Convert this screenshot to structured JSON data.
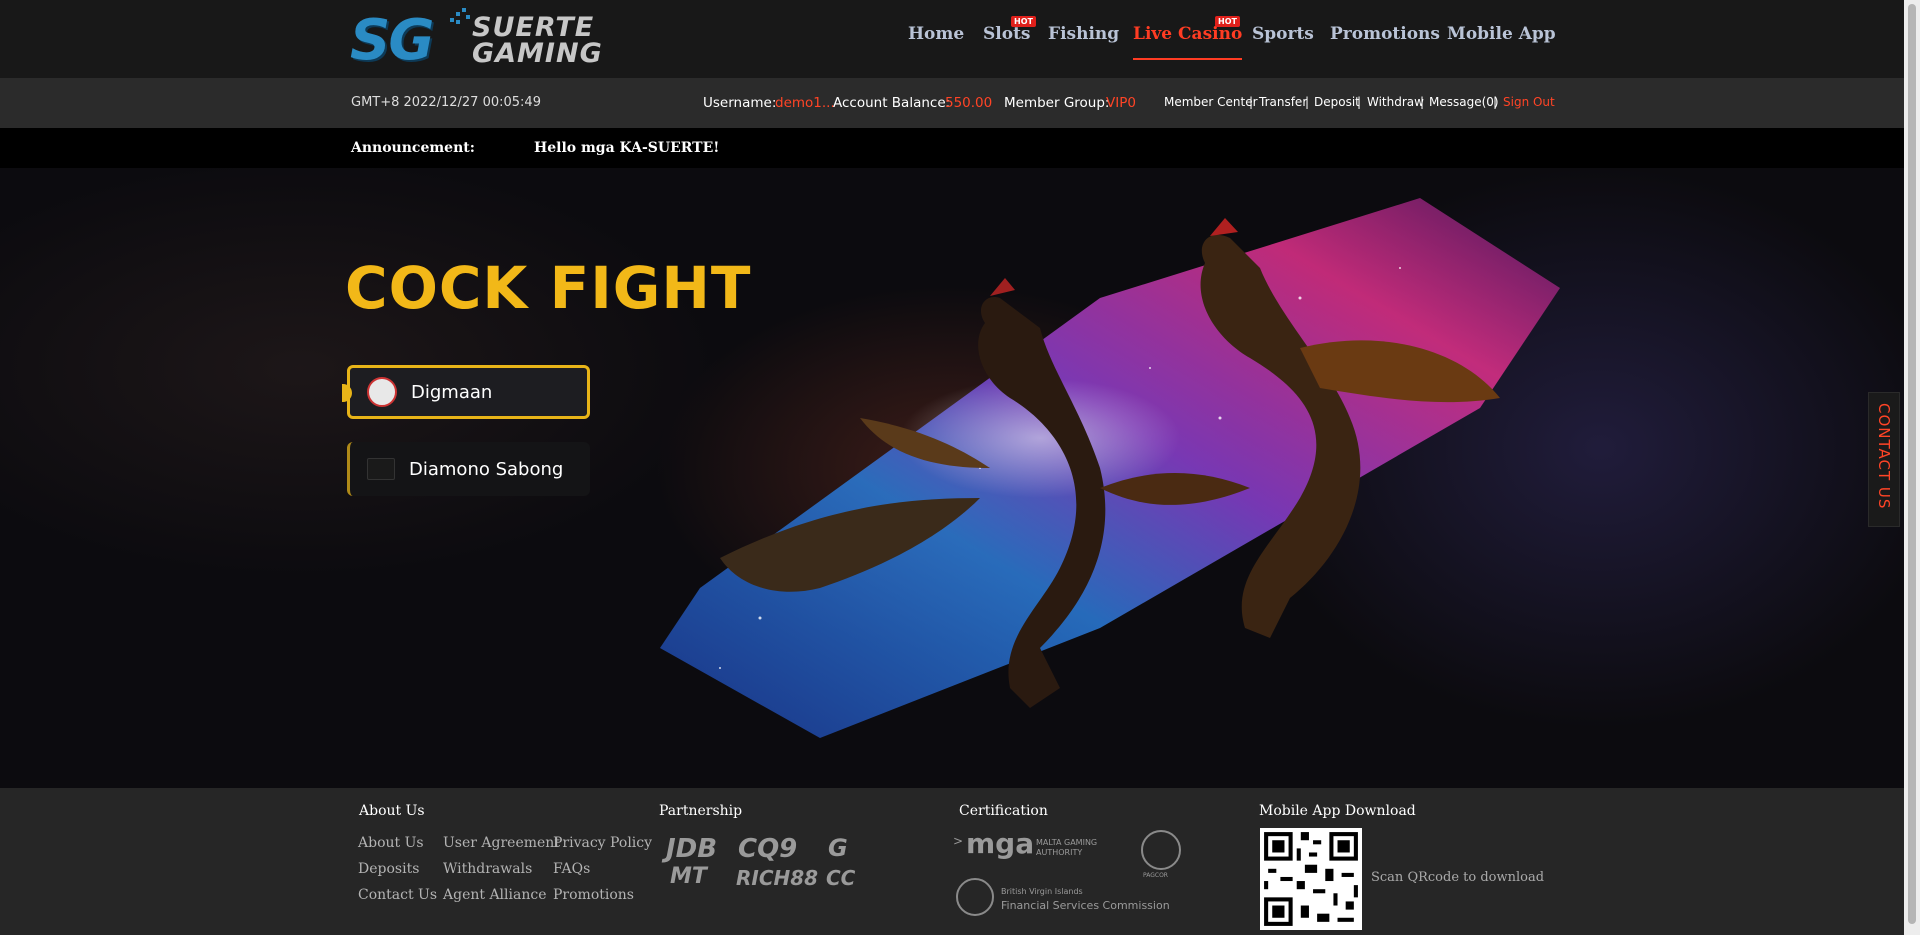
{
  "logo": {
    "mark": "SG",
    "line1": "SUERTE",
    "line2": "GAMING"
  },
  "nav": [
    {
      "label": "Home",
      "hot": ""
    },
    {
      "label": "Slots",
      "hot": "HOT"
    },
    {
      "label": "Fishing",
      "hot": ""
    },
    {
      "label": "Live Casino",
      "hot": "HOT"
    },
    {
      "label": "Sports",
      "hot": ""
    },
    {
      "label": "Promotions",
      "hot": ""
    },
    {
      "label": "Mobile App",
      "hot": ""
    }
  ],
  "infobar": {
    "clock": "GMT+8 2022/12/27 00:05:49",
    "username_label": "Username:",
    "username": "demo1...",
    "balance_label": "Account Balance:",
    "balance": "550.00",
    "group_label": "Member Group:",
    "group": "VIP0",
    "links": [
      "Member Center",
      "Transfer",
      "Deposit",
      "Withdraw",
      "Message(0)",
      "Sign Out"
    ]
  },
  "announcement": {
    "label": "Announcement:",
    "text": "Hello mga KA-SUERTE!"
  },
  "hero": {
    "title": "COCK FIGHT",
    "providers": [
      {
        "label": "Digmaan",
        "selected": true
      },
      {
        "label": "Diamono Sabong",
        "selected": false
      }
    ],
    "contact": "CONTACT US"
  },
  "footer": {
    "about": {
      "title": "About Us",
      "links": [
        [
          "About Us",
          "User Agreement",
          "Privacy Policy"
        ],
        [
          "Deposits",
          "Withdrawals",
          "FAQs"
        ],
        [
          "Contact Us",
          "Agent Alliance",
          "Promotions"
        ]
      ]
    },
    "partnership": {
      "title": "Partnership",
      "logos": [
        "JDB",
        "CQ9",
        "G",
        "MT",
        "RICH88",
        "CC"
      ]
    },
    "certification": {
      "title": "Certification",
      "mga_mark": "mga",
      "mga_sub1": "MALTA GAMING",
      "mga_sub2": "AUTHORITY",
      "pagcor": "PAGCOR",
      "bvi_line1": "British Virgin Islands",
      "bvi_line2": "Financial Services Commission"
    },
    "mobile": {
      "title": "Mobile App Download",
      "hint": "Scan QRcode to download"
    }
  },
  "colors": {
    "accent": "#ff3c23",
    "gold": "#f2b818",
    "nav": "#b9c3d6"
  }
}
